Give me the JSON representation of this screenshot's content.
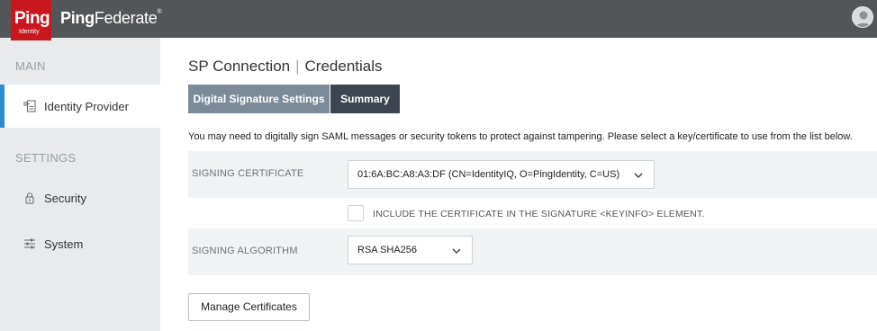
{
  "header": {
    "logo_main": "Ping",
    "logo_sub": "Identity",
    "product_bold": "Ping",
    "product_rest": "Federate",
    "product_mark": "®",
    "user_icon": "user-avatar-icon"
  },
  "sidebar": {
    "section_main": "MAIN",
    "section_settings": "SETTINGS",
    "items": [
      {
        "label": "Identity Provider",
        "icon": "identity-provider-icon",
        "active": true
      },
      {
        "label": "Security",
        "icon": "lock-icon",
        "active": false
      },
      {
        "label": "System",
        "icon": "sliders-icon",
        "active": false
      }
    ]
  },
  "main": {
    "title_left": "SP Connection",
    "title_sep": "|",
    "title_right": "Credentials",
    "tabs": [
      {
        "label": "Digital Signature Settings"
      },
      {
        "label": "Summary"
      }
    ],
    "instructions": "You may need to digitally sign SAML messages or security tokens to protect against tampering. Please select a key/certificate to use from the list below.",
    "signing_certificate": {
      "label": "SIGNING CERTIFICATE",
      "value": "01:6A:BC:A8:A3:DF (CN=IdentityIQ, O=PingIdentity, C=US)"
    },
    "include_cert": {
      "label": "INCLUDE THE CERTIFICATE IN THE SIGNATURE <KEYINFO> ELEMENT.",
      "checked": false
    },
    "signing_algorithm": {
      "label": "SIGNING ALGORITHM",
      "value": "RSA SHA256"
    },
    "manage_button": "Manage Certificates"
  },
  "colors": {
    "topbar": "#535659",
    "brand_red": "#c8171e",
    "active_bar": "#2d8ccf",
    "tab_inactive": "#7c8b99",
    "tab_active": "#3d4650"
  }
}
